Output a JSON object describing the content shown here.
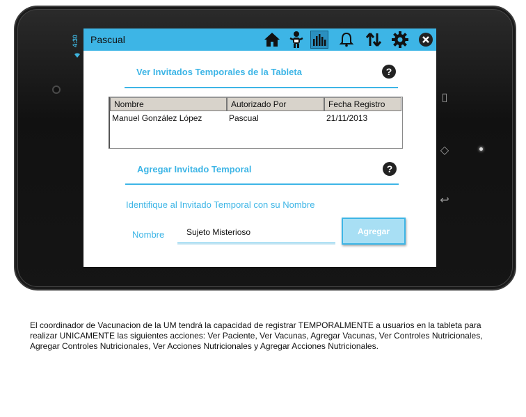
{
  "status_bar": {
    "time": "4:30"
  },
  "app_bar": {
    "title": "Pascual",
    "icons": [
      "home-icon",
      "baby-icon",
      "chart-icon",
      "bell-icon",
      "sync-icon",
      "gear-icon",
      "close-icon"
    ]
  },
  "invitados": {
    "title": "Ver Invitados Temporales de la Tableta",
    "help": "?",
    "columns": [
      "Nombre",
      "Autorizado Por",
      "Fecha Registro"
    ],
    "rows": [
      {
        "nombre": "Manuel González López",
        "autorizado": "Pascual",
        "fecha": "21/11/2013"
      }
    ]
  },
  "agregar": {
    "title": "Agregar Invitado Temporal",
    "help": "?",
    "instruction": "Identifique al Invitado Temporal con su Nombre",
    "name_label": "Nombre",
    "name_value": "Sujeto Misterioso",
    "button_label": "Agregar"
  },
  "description": "El coordinador de Vacunacion de la UM tendrá la capacidad de registrar TEMPORALMENTE a usuarios en la tableta para realizar UNICAMENTE las siguientes acciones: Ver Paciente, Ver Vacunas, Agregar Vacunas, Ver Controles Nutricionales, Agregar Controles Nutricionales, Ver Acciones Nutricionales y Agregar Acciones Nutricionales.",
  "colors": {
    "accent": "#3db5e6",
    "appbar": "#3db5e6",
    "button_fill": "#a8dff4"
  }
}
